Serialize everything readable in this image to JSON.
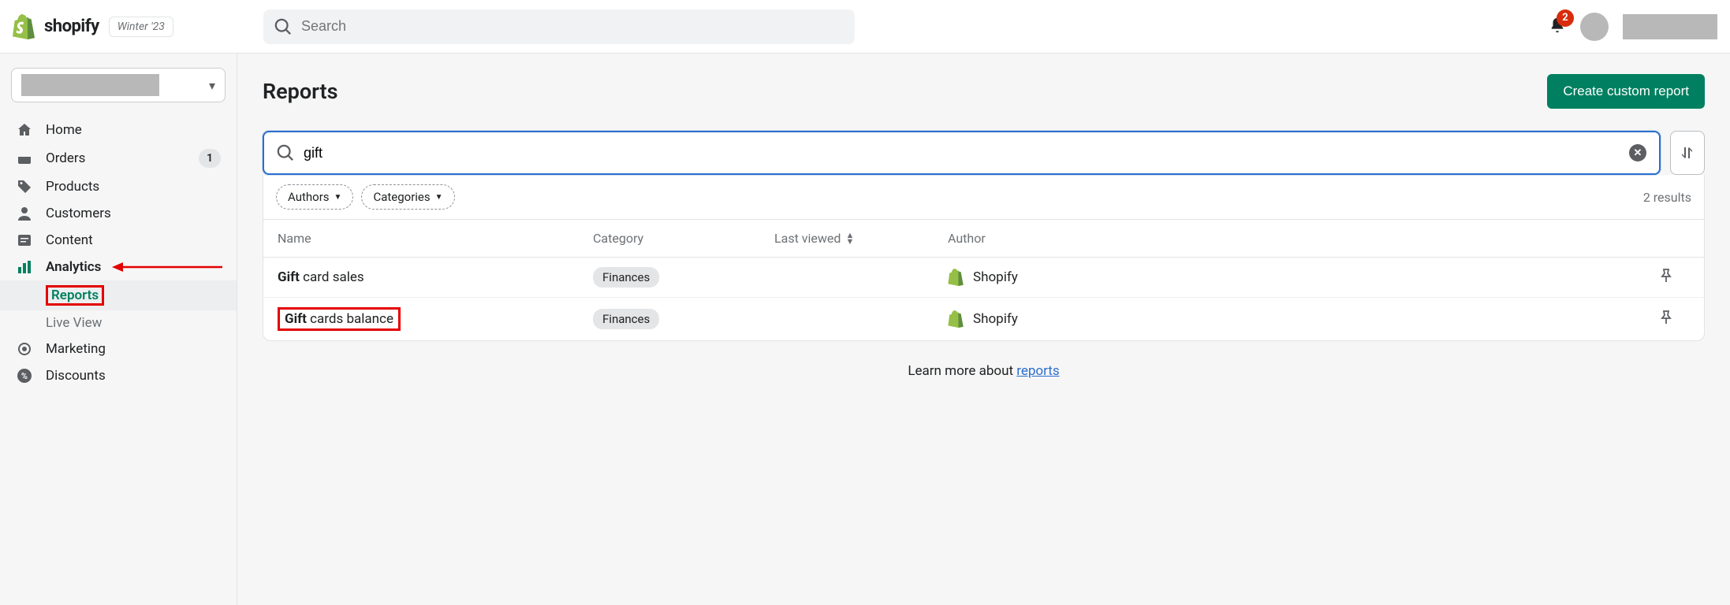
{
  "topbar": {
    "brand": "shopify",
    "edition": "Winter '23",
    "search_placeholder": "Search",
    "notification_count": "2"
  },
  "sidebar": {
    "items": [
      {
        "label": "Home"
      },
      {
        "label": "Orders",
        "badge": "1"
      },
      {
        "label": "Products"
      },
      {
        "label": "Customers"
      },
      {
        "label": "Content"
      },
      {
        "label": "Analytics"
      },
      {
        "label": "Marketing"
      },
      {
        "label": "Discounts"
      }
    ],
    "analytics_sub": {
      "reports": "Reports",
      "live_view": "Live View"
    }
  },
  "page": {
    "title": "Reports",
    "create_btn": "Create custom report",
    "search_value": "gift",
    "filters": {
      "authors": "Authors",
      "categories": "Categories"
    },
    "results_text": "2 results",
    "columns": {
      "name": "Name",
      "category": "Category",
      "last_viewed": "Last viewed",
      "author": "Author"
    },
    "rows": [
      {
        "hl": "Gift",
        "rest": " card sales",
        "category": "Finances",
        "author": "Shopify",
        "boxed": false
      },
      {
        "hl": "Gift",
        "rest": " cards balance",
        "category": "Finances",
        "author": "Shopify",
        "boxed": true
      }
    ],
    "learn_more_prefix": "Learn more about ",
    "learn_more_link": "reports"
  }
}
